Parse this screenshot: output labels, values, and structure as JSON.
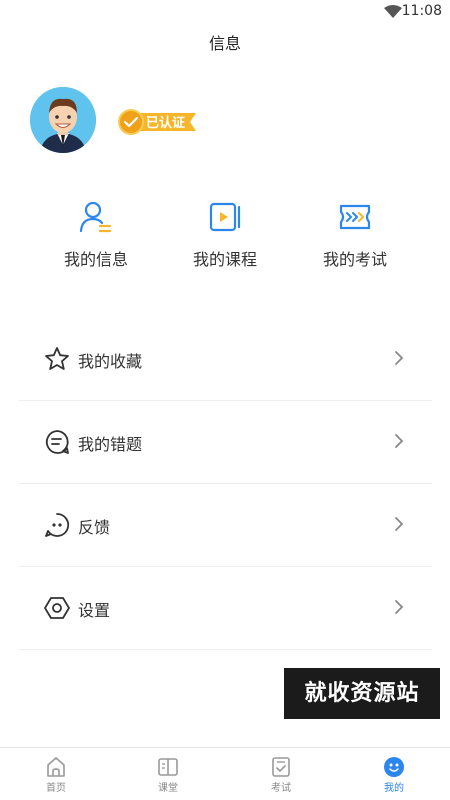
{
  "status": {
    "time": "11:08"
  },
  "header": {
    "title": "信息"
  },
  "profile": {
    "badge": "已认证"
  },
  "quick_actions": [
    {
      "label": "我的信息",
      "icon": "user-info-icon"
    },
    {
      "label": "我的课程",
      "icon": "course-video-icon"
    },
    {
      "label": "我的考试",
      "icon": "exam-arrows-icon"
    }
  ],
  "menu": [
    {
      "label": "我的收藏",
      "icon": "star-icon"
    },
    {
      "label": "我的错题",
      "icon": "chat-lines-icon"
    },
    {
      "label": "反馈",
      "icon": "feedback-dots-icon"
    },
    {
      "label": "设置",
      "icon": "hexagon-settings-icon"
    }
  ],
  "watermark": "就收资源站",
  "tabs": [
    {
      "label": "首页",
      "icon": "home-icon",
      "active": false
    },
    {
      "label": "课堂",
      "icon": "book-icon",
      "active": false
    },
    {
      "label": "考试",
      "icon": "checklist-icon",
      "active": false
    },
    {
      "label": "我的",
      "icon": "smile-icon",
      "active": true
    }
  ],
  "colors": {
    "accent": "#2b87ee",
    "badge": "#f6b62a",
    "avatar_bg": "#5fc3ee"
  }
}
